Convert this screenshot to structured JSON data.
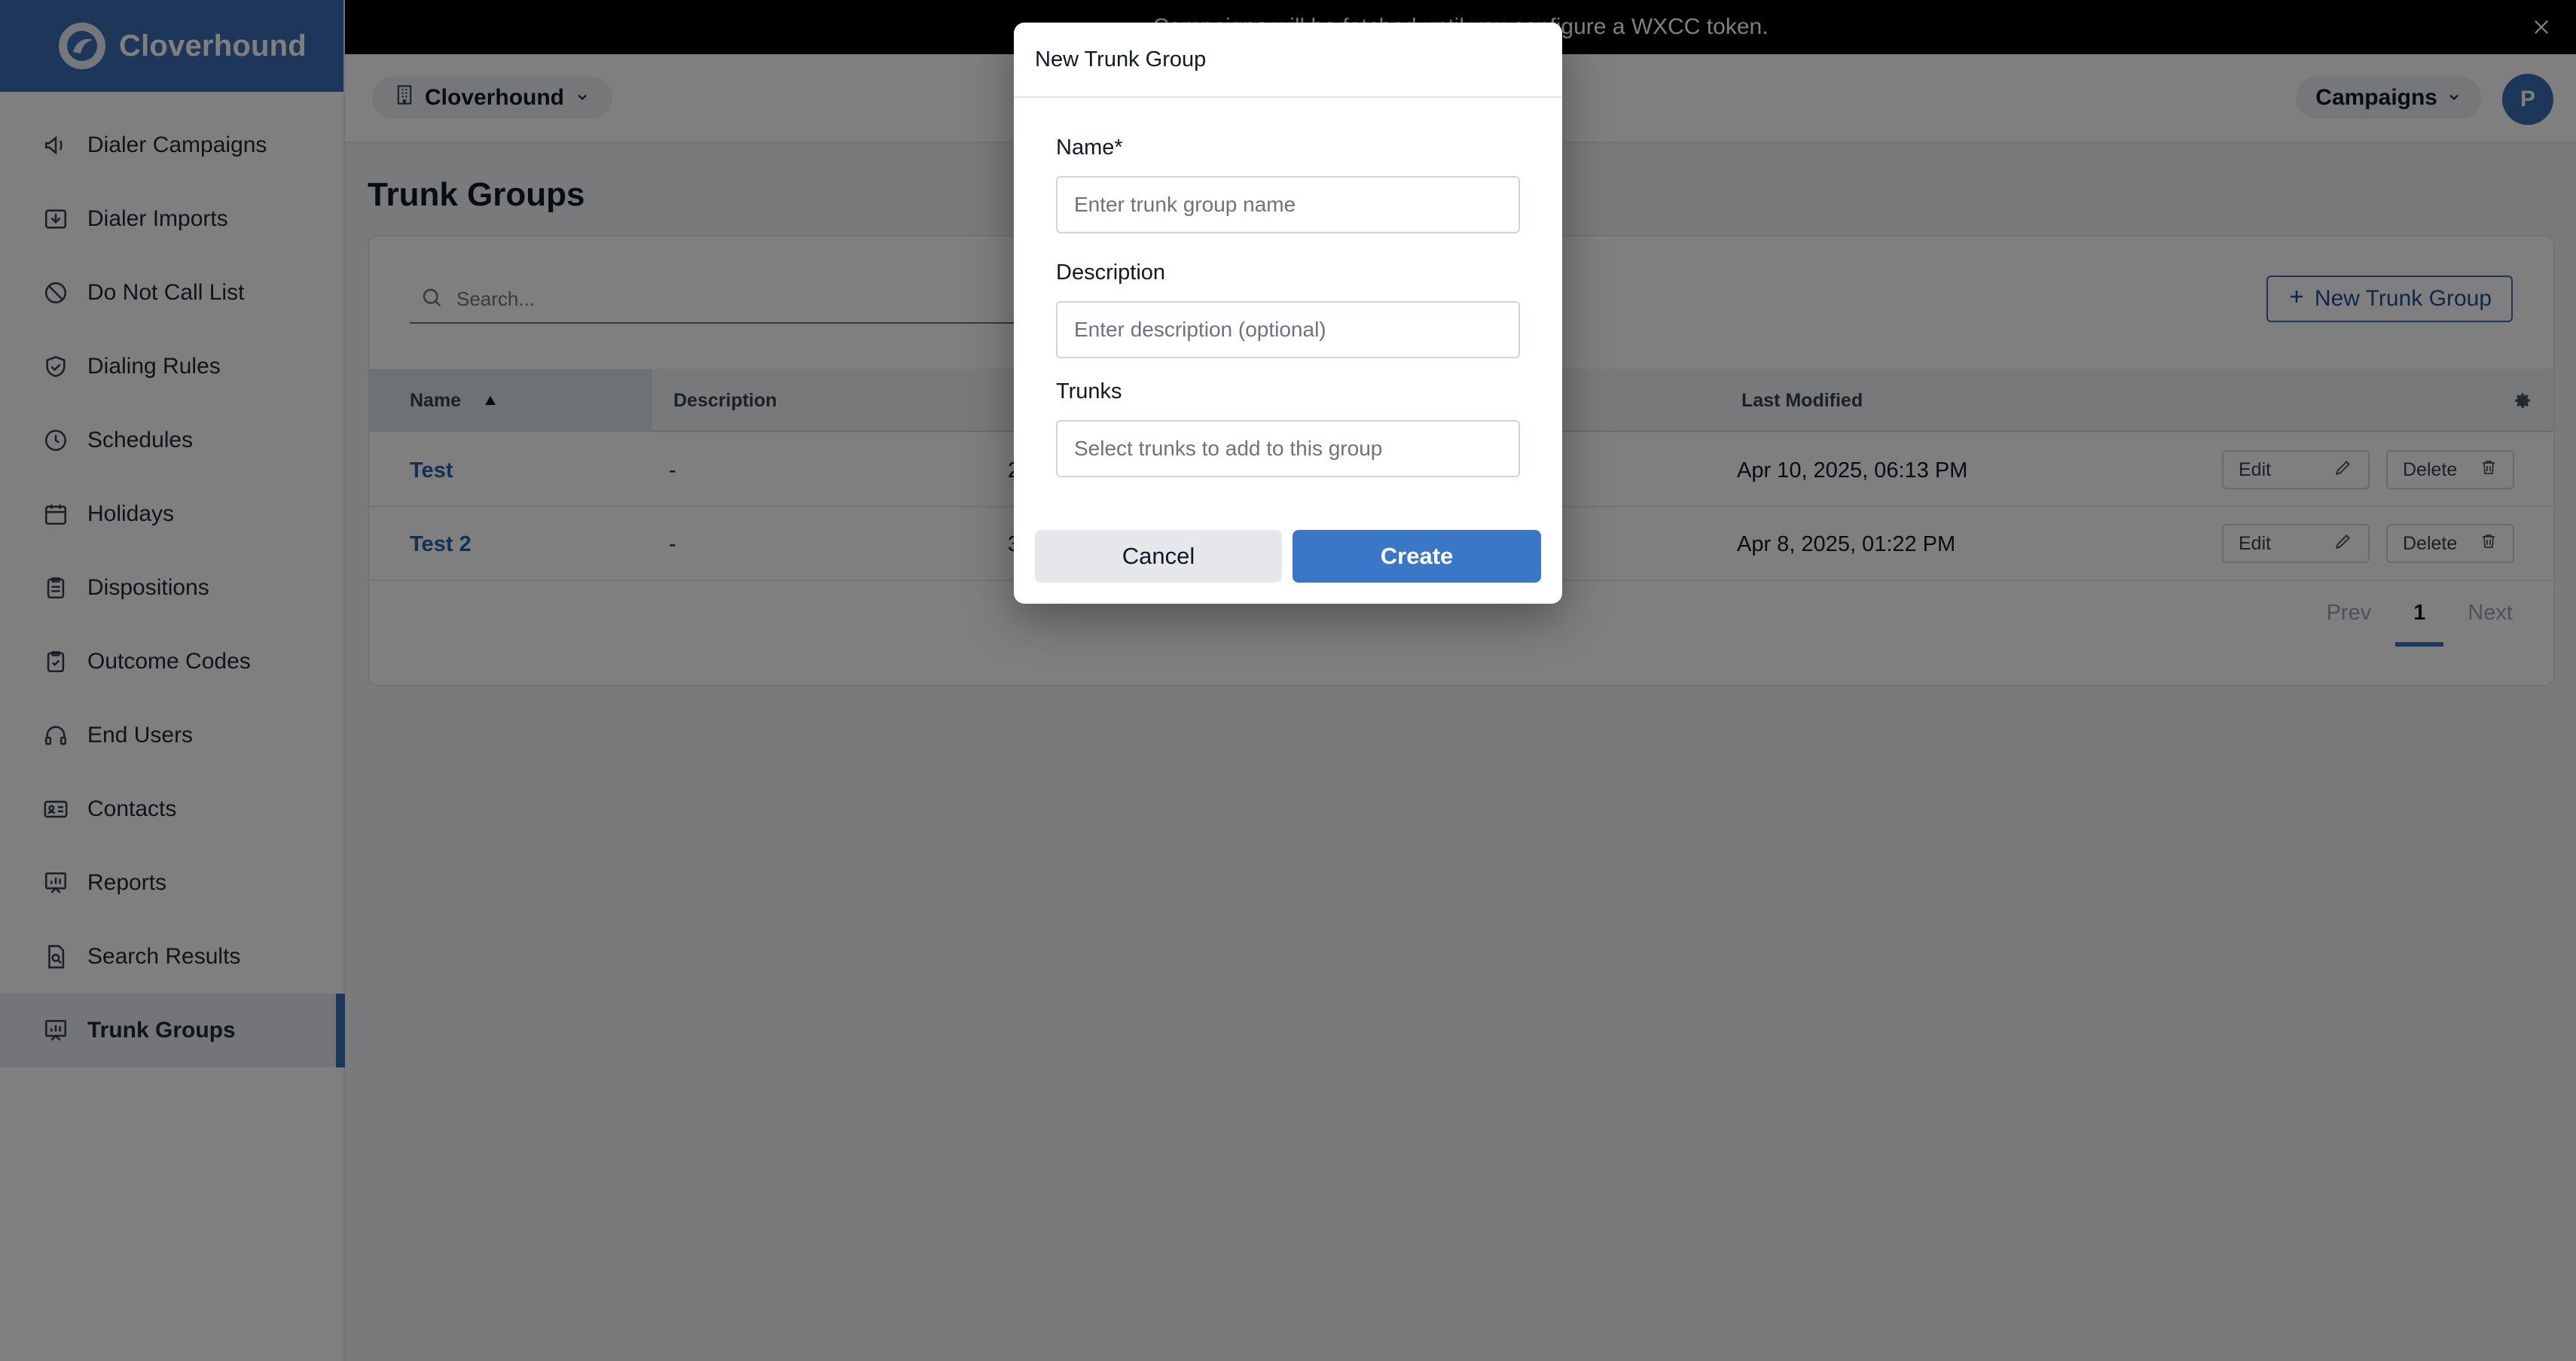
{
  "brand": {
    "name": "Cloverhound"
  },
  "sidebar": {
    "items": [
      {
        "label": "Dialer Campaigns",
        "icon": "megaphone-icon"
      },
      {
        "label": "Dialer Imports",
        "icon": "import-icon"
      },
      {
        "label": "Do Not Call List",
        "icon": "prohibited-icon"
      },
      {
        "label": "Dialing Rules",
        "icon": "shield-check-icon"
      },
      {
        "label": "Schedules",
        "icon": "clock-icon"
      },
      {
        "label": "Holidays",
        "icon": "calendar-icon"
      },
      {
        "label": "Dispositions",
        "icon": "clipboard-list-icon"
      },
      {
        "label": "Outcome Codes",
        "icon": "clipboard-check-icon"
      },
      {
        "label": "End Users",
        "icon": "headset-icon"
      },
      {
        "label": "Contacts",
        "icon": "contact-card-icon"
      },
      {
        "label": "Reports",
        "icon": "report-icon"
      },
      {
        "label": "Search Results",
        "icon": "document-search-icon"
      },
      {
        "label": "Trunk Groups",
        "icon": "trunk-chart-icon",
        "active": true
      }
    ]
  },
  "banner": {
    "text": "Campaigns will be fetched until you configure a WXCC token."
  },
  "header": {
    "org": "Cloverhound",
    "campaigns": "Campaigns",
    "avatar": "P"
  },
  "page": {
    "title": "Trunk Groups"
  },
  "toolbar": {
    "search_placeholder": "Search...",
    "new_button": "New Trunk Group"
  },
  "table": {
    "columns": {
      "name": "Name",
      "description": "Description",
      "last_modified": "Last Modified"
    },
    "rows": [
      {
        "name": "Test",
        "description": "-",
        "trunks": "2",
        "last_modified": "Apr 10, 2025, 06:13 PM",
        "edit": "Edit",
        "delete": "Delete"
      },
      {
        "name": "Test 2",
        "description": "-",
        "trunks": "3",
        "last_modified": "Apr 8, 2025, 01:22 PM",
        "edit": "Edit",
        "delete": "Delete"
      }
    ]
  },
  "pagination": {
    "prev": "Prev",
    "current": "1",
    "next": "Next"
  },
  "modal": {
    "title": "New Trunk Group",
    "name_label": "Name*",
    "name_placeholder": "Enter trunk group name",
    "description_label": "Description",
    "description_placeholder": "Enter description (optional)",
    "trunks_label": "Trunks",
    "trunks_placeholder": "Select trunks to add to this group",
    "cancel": "Cancel",
    "create": "Create"
  },
  "colors": {
    "brand": "#3b6fb6",
    "primary_button": "#3b77c9",
    "link": "#2563a8",
    "banner": "#000000"
  }
}
